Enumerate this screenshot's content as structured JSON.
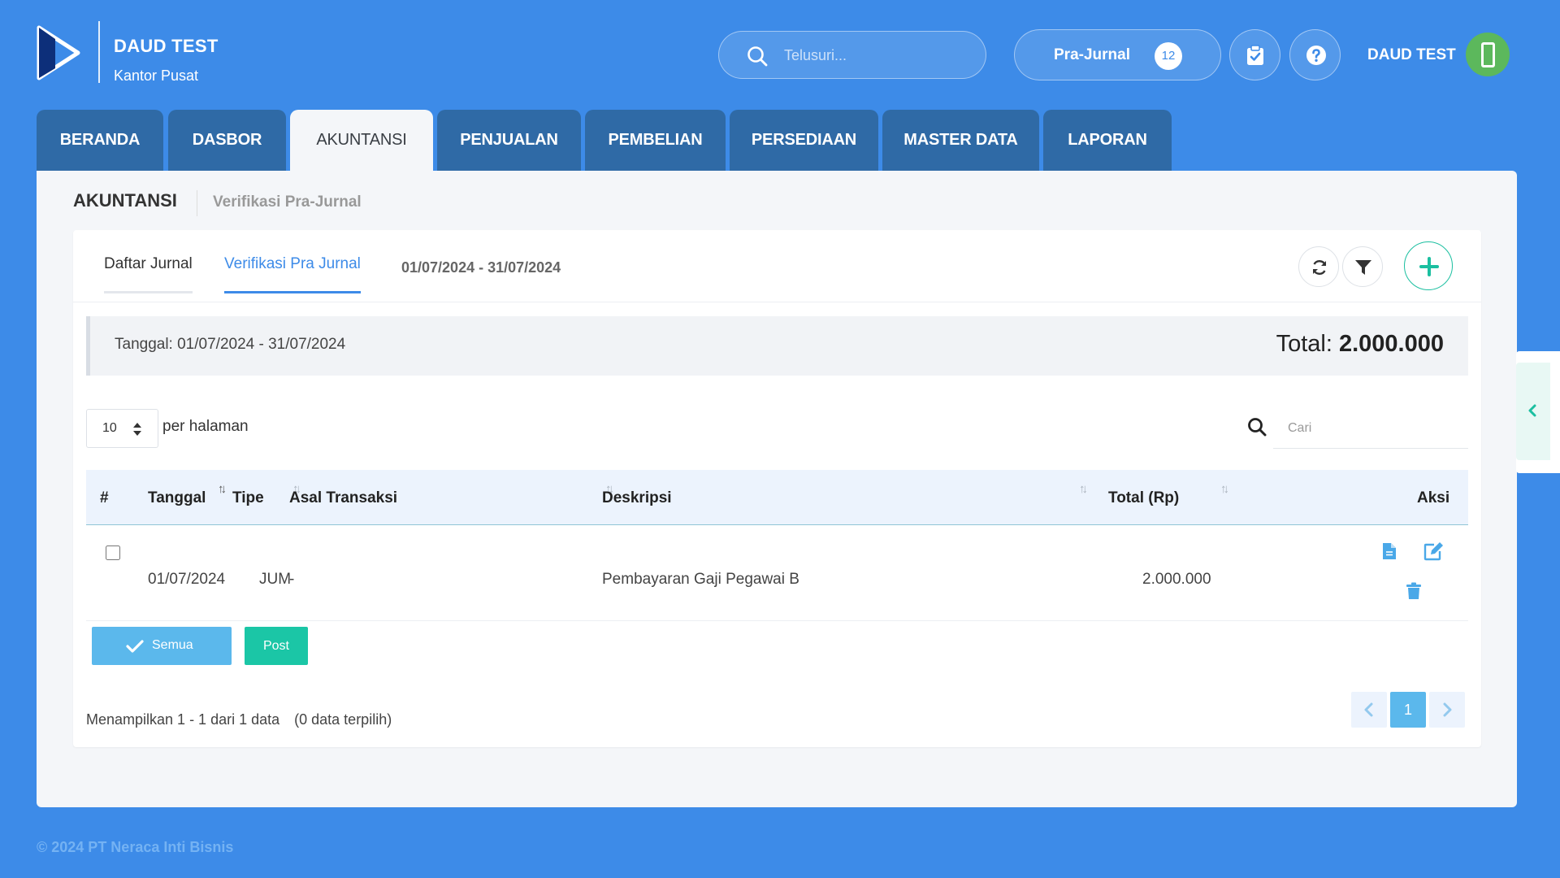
{
  "brand": {
    "company_name": "DAUD TEST",
    "branch": "Kantor Pusat"
  },
  "header": {
    "search_placeholder": "Telusuri...",
    "prajurnal_label": "Pra-Jurnal",
    "prajurnal_count": "12",
    "user_name": "DAUD TEST"
  },
  "nav": {
    "tabs": [
      "BERANDA",
      "DASBOR",
      "AKUNTANSI",
      "PENJUALAN",
      "PEMBELIAN",
      "PERSEDIAAN",
      "MASTER DATA",
      "LAPORAN"
    ],
    "active": "AKUNTANSI"
  },
  "breadcrumb": {
    "main": "AKUNTANSI",
    "sub": "Verifikasi Pra-Jurnal"
  },
  "subtabs": {
    "daftar": "Daftar Jurnal",
    "verifikasi": "Verifikasi Pra Jurnal",
    "date_range": "01/07/2024 - 31/07/2024"
  },
  "summary": {
    "date_text": "Tanggal: 01/07/2024 - 31/07/2024",
    "total_label": "Total:",
    "total_value": "2.000.000"
  },
  "table_controls": {
    "per_page_value": "10",
    "per_page_label": "per halaman",
    "search_placeholder": "Cari"
  },
  "table": {
    "headers": {
      "index": "#",
      "tanggal": "Tanggal",
      "tipe": "Tipe",
      "asal": "Asal Transaksi",
      "deskripsi": "Deskripsi",
      "total": "Total (Rp)",
      "aksi": "Aksi"
    },
    "rows": [
      {
        "tanggal": "01/07/2024",
        "tipe": "JUM",
        "asal": "-",
        "deskripsi": "Pembayaran Gaji Pegawai B",
        "total": "2.000.000",
        "checked": false
      }
    ]
  },
  "actions": {
    "select_all": "Semua",
    "post": "Post"
  },
  "footer": {
    "showing": "Menampilkan 1 - 1 dari 1 data",
    "selected": "(0 data terpilih)",
    "current_page": "1"
  },
  "copyright": "© 2024 PT Neraca Inti Bisnis",
  "colors": {
    "background": "#3d8be8",
    "nav_tab": "#2f6aa6",
    "accent": "#3d8be8",
    "teal": "#1bc6a6",
    "light_blue_button": "#5bb8ec",
    "avatar": "#5cb85c"
  },
  "icons": {
    "logo": "play-logo-icon",
    "search": "search-icon",
    "clipboard": "clipboard-check-icon",
    "help": "question-circle-icon",
    "refresh": "refresh-icon",
    "filter": "filter-icon",
    "add": "plus-icon",
    "document": "document-icon",
    "edit": "edit-icon",
    "delete": "trash-icon",
    "check": "check-icon",
    "prev": "chevron-left-icon",
    "next": "chevron-right-icon"
  }
}
